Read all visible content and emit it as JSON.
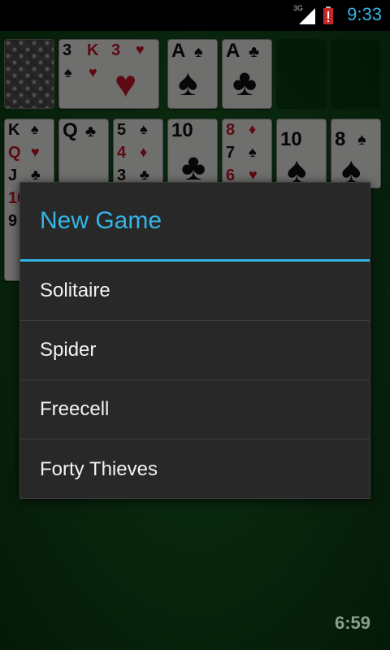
{
  "status_bar": {
    "network": "3G",
    "time": "9:33",
    "accent_color": "#33b5e5",
    "icons": [
      "signal-icon",
      "battery-alert-icon"
    ]
  },
  "game": {
    "timer": "6:59",
    "foundation": [
      {
        "rank": "A",
        "suit": "♠"
      },
      {
        "rank": "A",
        "suit": "♣"
      }
    ],
    "waste": [
      {
        "rank": "3",
        "suit": "♠"
      },
      {
        "rank": "K",
        "suit": "♥"
      },
      {
        "rank": "3",
        "suit": "♥"
      }
    ],
    "tableau": [
      {
        "cards": [
          {
            "rank": "K",
            "suit": "♠"
          },
          {
            "rank": "Q",
            "suit": "♥"
          },
          {
            "rank": "J",
            "suit": "♣"
          },
          {
            "rank": "10",
            "suit": "♥"
          },
          {
            "rank": "9",
            "suit": "♠"
          }
        ]
      },
      {
        "cards": [
          {
            "rank": "Q",
            "suit": "♣"
          }
        ]
      },
      {
        "cards": [
          {
            "rank": "5",
            "suit": "♠"
          },
          {
            "rank": "4",
            "suit": "♦"
          },
          {
            "rank": "3",
            "suit": "♣"
          }
        ]
      },
      {
        "cards": [
          {
            "rank": "10",
            "suit": "♣"
          }
        ]
      },
      {
        "cards": [
          {
            "rank": "8",
            "suit": "♦"
          },
          {
            "rank": "7",
            "suit": "♠"
          },
          {
            "rank": "6",
            "suit": "♥"
          }
        ]
      },
      {
        "cards": [
          {
            "rank": "10",
            "suit": "♠"
          }
        ]
      },
      {
        "cards": [
          {
            "rank": "8",
            "suit": "♠"
          }
        ]
      }
    ]
  },
  "dialog": {
    "title": "New Game",
    "items": [
      "Solitaire",
      "Spider",
      "Freecell",
      "Forty Thieves"
    ],
    "accent_color": "#33b5e5"
  }
}
